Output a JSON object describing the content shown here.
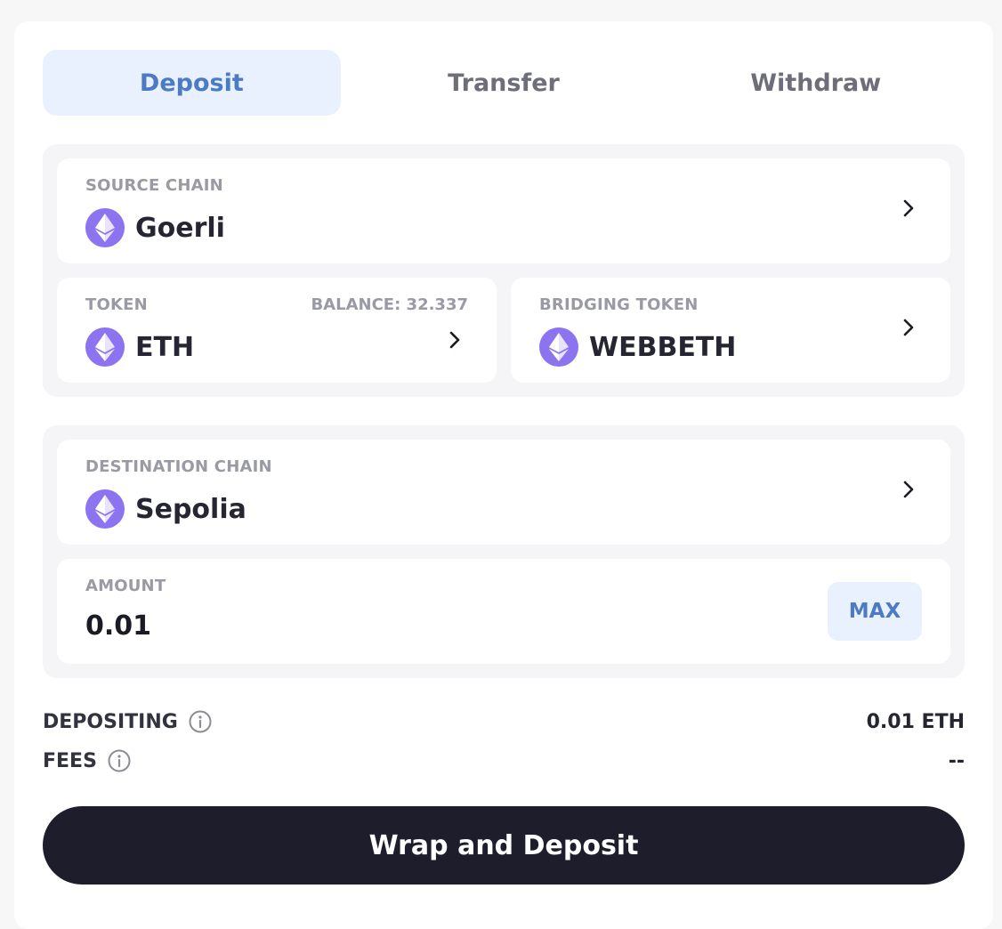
{
  "tabs": [
    {
      "label": "Deposit"
    },
    {
      "label": "Transfer"
    },
    {
      "label": "Withdraw"
    }
  ],
  "source_chain": {
    "label": "SOURCE CHAIN",
    "value": "Goerli",
    "icon": "ethereum-icon"
  },
  "token": {
    "label": "TOKEN",
    "balance": "BALANCE: 32.337",
    "value": "ETH",
    "icon": "ethereum-icon"
  },
  "bridging_token": {
    "label": "BRIDGING TOKEN",
    "value": "WEBBETH",
    "icon": "ethereum-icon"
  },
  "destination_chain": {
    "label": "DESTINATION CHAIN",
    "value": "Sepolia",
    "icon": "ethereum-icon"
  },
  "amount": {
    "label": "AMOUNT",
    "value": "0.01",
    "max_label": "MAX"
  },
  "summary": {
    "depositing_label": "DEPOSITING",
    "depositing_value": "0.01 ETH",
    "fees_label": "FEES",
    "fees_value": "--"
  },
  "cta_label": "Wrap and Deposit",
  "colors": {
    "accent": "#4a7bc4",
    "eth_icon": "#8c73f0",
    "cta_bg": "#1e1d2b"
  }
}
